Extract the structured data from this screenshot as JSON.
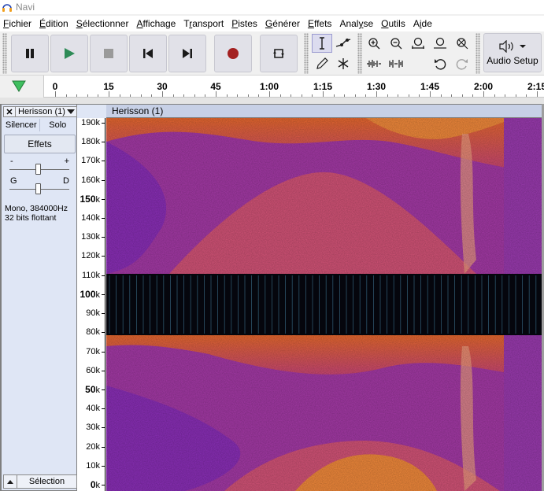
{
  "window": {
    "title": "Navi"
  },
  "menu": [
    {
      "label": "Fichier",
      "mn": "F",
      "rest": "ichier"
    },
    {
      "label": "Édition",
      "mn": "É",
      "rest": "dition"
    },
    {
      "label": "Sélectionner",
      "mn": "S",
      "rest": "électionner"
    },
    {
      "label": "Affichage",
      "mn": "A",
      "rest": "ffichage"
    },
    {
      "label": "Transport",
      "pre": "T",
      "mn": "r",
      "rest": "ansport"
    },
    {
      "label": "Pistes",
      "mn": "P",
      "rest": "istes"
    },
    {
      "label": "Générer",
      "mn": "G",
      "rest": "énérer"
    },
    {
      "label": "Effets",
      "mn": "E",
      "rest": "ffets"
    },
    {
      "label": "Analyse",
      "pre": "Anal",
      "mn": "y",
      "rest": "se"
    },
    {
      "label": "Outils",
      "mn": "O",
      "rest": "utils"
    },
    {
      "label": "Aide",
      "pre": "A",
      "mn": "i",
      "rest": "de"
    }
  ],
  "toolbar": {
    "audio_setup_label": "Audio Setup",
    "transport_buttons": [
      "pause",
      "play",
      "stop",
      "skip-to-start",
      "skip-to-end",
      "record",
      "loop"
    ],
    "colors": {
      "play": "#2e8b57",
      "record": "#a32020",
      "icon": "#1a1a1a",
      "disabled": "#9a9a9a"
    }
  },
  "ruler": {
    "labels": [
      "0",
      "15",
      "30",
      "45",
      "1:00",
      "1:15",
      "1:30",
      "1:45",
      "2:00",
      "2:15"
    ]
  },
  "track": {
    "name": "Herisson (1)",
    "mute_label": "Silencer",
    "solo_label": "Solo",
    "effects_label": "Effets",
    "gain_minus": "-",
    "gain_plus": "+",
    "pan_left": "G",
    "pan_right": "D",
    "info_line1": "Mono, 384000Hz",
    "info_line2": "32 bits flottant",
    "select_label": "Sélection",
    "gain_level": 0.5,
    "pan_level": 0.5
  },
  "clip": {
    "name": "Herisson (1)"
  },
  "freq_scale": [
    {
      "v": "190",
      "u": "k",
      "bold": false
    },
    {
      "v": "180",
      "u": "k",
      "bold": false
    },
    {
      "v": "170",
      "u": "k",
      "bold": false
    },
    {
      "v": "160",
      "u": "k",
      "bold": false
    },
    {
      "v": "150",
      "u": "k",
      "bold": true
    },
    {
      "v": "140",
      "u": "k",
      "bold": false
    },
    {
      "v": "130",
      "u": "k",
      "bold": false
    },
    {
      "v": "120",
      "u": "k",
      "bold": false
    },
    {
      "v": "110",
      "u": "k",
      "bold": false
    },
    {
      "v": "100",
      "u": "k",
      "bold": true
    },
    {
      "v": "90",
      "u": "k",
      "bold": false
    },
    {
      "v": "80",
      "u": "k",
      "bold": false
    },
    {
      "v": "70",
      "u": "k",
      "bold": false
    },
    {
      "v": "60",
      "u": "k",
      "bold": false
    },
    {
      "v": "50",
      "u": "k",
      "bold": true
    },
    {
      "v": "40",
      "u": "k",
      "bold": false
    },
    {
      "v": "30",
      "u": "k",
      "bold": false
    },
    {
      "v": "20",
      "u": "k",
      "bold": false
    },
    {
      "v": "10",
      "u": "k",
      "bold": false
    },
    {
      "v": "0",
      "u": "k",
      "bold": true
    }
  ],
  "spectrogram_colors": {
    "hot": "#f07a3a",
    "warm": "#d6497a",
    "cool": "#8a2fb5",
    "band": "#05060d",
    "band_line": "#3b6f8a"
  }
}
